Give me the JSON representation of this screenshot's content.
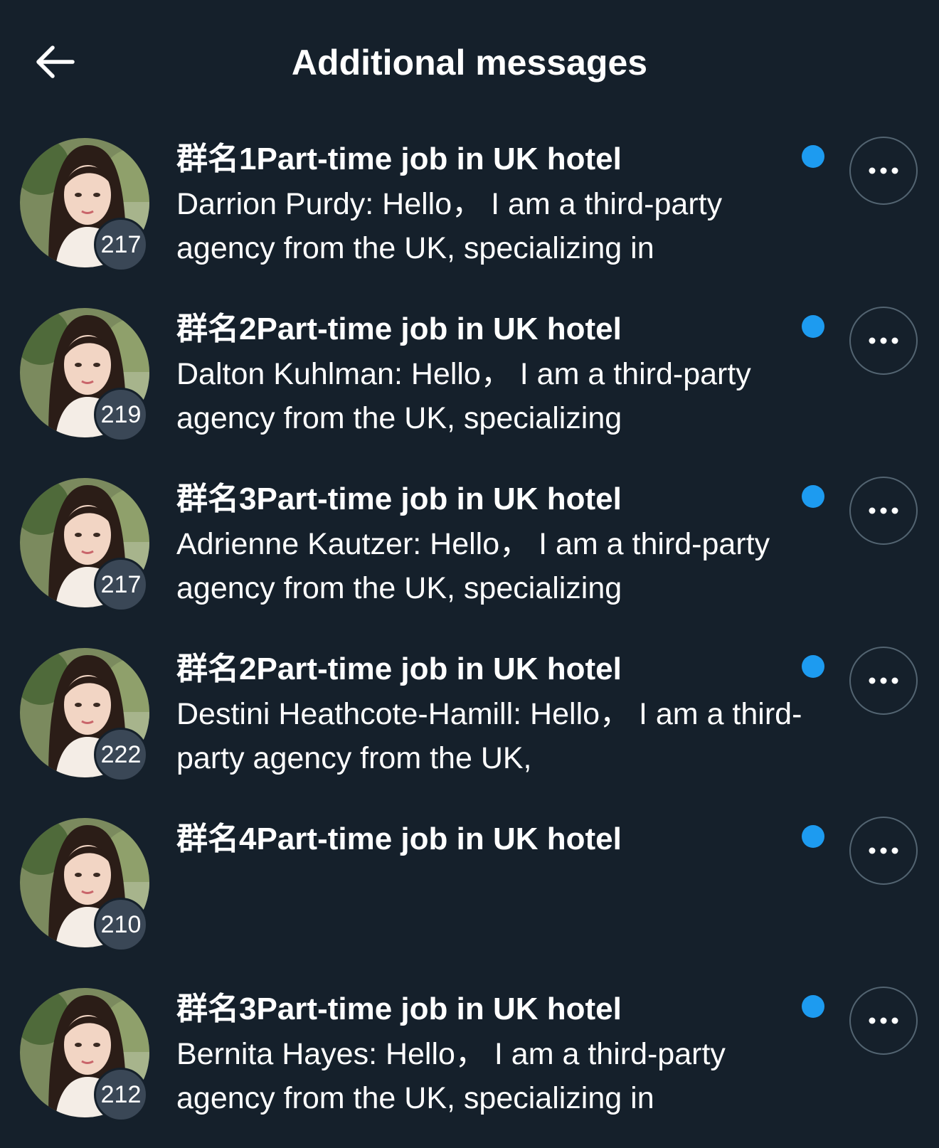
{
  "header": {
    "title": "Additional messages",
    "back_icon": "arrow-left-icon"
  },
  "colors": {
    "background": "#15202b",
    "unread_dot": "#1d9bf0",
    "badge": "#3a4756",
    "more_border": "#536471"
  },
  "conversations": [
    {
      "title": "群名1Part-time job in UK hotel",
      "preview": "Darrion Purdy: Hello， I am a third-party agency from the UK, specializing in",
      "count": "217",
      "unread": true
    },
    {
      "title": "群名2Part-time job in UK hotel",
      "preview": "Dalton Kuhlman: Hello， I am a third-party agency from the UK, specializing",
      "count": "219",
      "unread": true
    },
    {
      "title": "群名3Part-time job in UK hotel",
      "preview": "Adrienne Kautzer: Hello， I am a third-party agency from the UK, specializing",
      "count": "217",
      "unread": true
    },
    {
      "title": "群名2Part-time job in UK hotel",
      "preview": "Destini Heathcote-Hamill: Hello， I am a third-party agency from the UK,",
      "count": "222",
      "unread": true
    },
    {
      "title": "群名4Part-time job in UK hotel",
      "preview": "",
      "count": "210",
      "unread": true
    },
    {
      "title": "群名3Part-time job in UK hotel",
      "preview": "Bernita Hayes: Hello， I am a third-party agency from the UK, specializing in",
      "count": "212",
      "unread": true
    }
  ]
}
